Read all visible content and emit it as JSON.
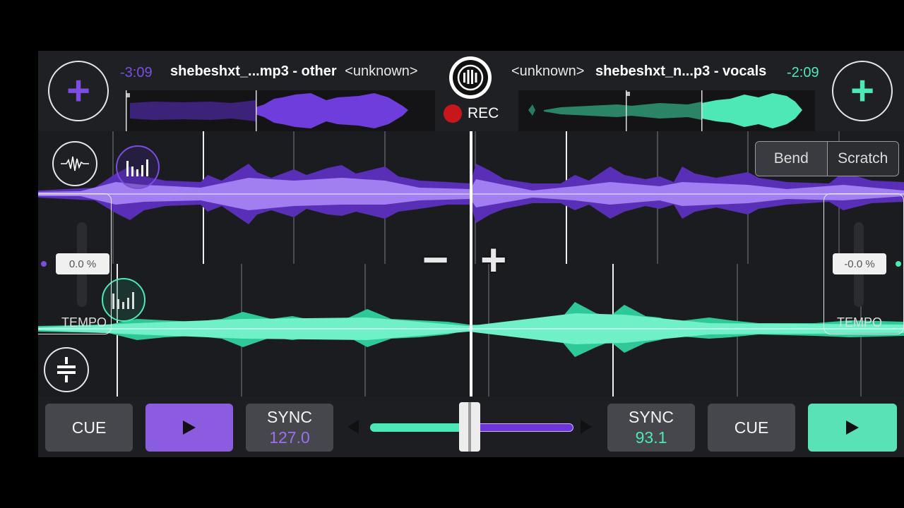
{
  "deck_left": {
    "time": "-3:09",
    "title": "shebeshxt_...mp3 - other",
    "artist": "<unknown>",
    "tempo_value": "0.0 %",
    "tempo_label": "TEMPO",
    "cue_label": "CUE",
    "sync_label": "SYNC",
    "bpm": "127.0",
    "color": "#7b4de3"
  },
  "deck_right": {
    "time": "-2:09",
    "title": "shebeshxt_n...p3 - vocals",
    "artist": "<unknown>",
    "tempo_value": "-0.0 %",
    "tempo_label": "TEMPO",
    "cue_label": "CUE",
    "sync_label": "SYNC",
    "bpm": "93.1",
    "color": "#4de8b5"
  },
  "center": {
    "rec_label": "REC"
  },
  "mode_toggle": {
    "options": [
      "Bend",
      "Scratch"
    ],
    "selected": "Bend"
  },
  "crossfader": {
    "position": 0.5
  },
  "icons": {
    "add_left": "plus-icon",
    "add_right": "plus-icon",
    "logo": "record-logo-icon",
    "waveform_toggle": "waveform-icon",
    "bars_top": "bars-icon",
    "bars_bottom": "bars-icon",
    "eq": "equalizer-icon",
    "pitch_minus": "minus-icon",
    "pitch_plus": "plus-icon"
  }
}
